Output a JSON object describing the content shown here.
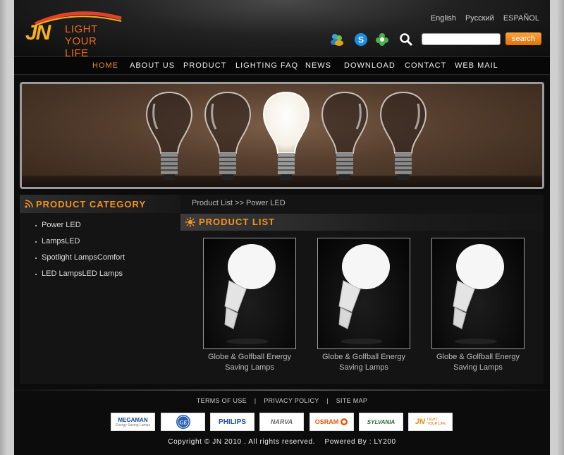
{
  "header": {
    "logo": {
      "initials": "JN",
      "line1": "LIGHT",
      "line2": "YOUR LIFE"
    },
    "languages": [
      "English",
      "Русский",
      "ESPAÑOL"
    ],
    "social_icons": [
      "msn-icon",
      "skype-icon",
      "qq-icon"
    ],
    "search": {
      "placeholder": "",
      "button_label": "search"
    }
  },
  "nav": {
    "items": [
      "HOME",
      "ABOUT US",
      "PRODUCT",
      "LIGHTING FAQ",
      "NEWS",
      "DOWNLOAD",
      "CONTACT",
      "WEB MAIL"
    ],
    "active": "HOME"
  },
  "sidebar": {
    "title": "PRODUCT CATEGORY",
    "items": [
      "Power LED",
      "LampsLED",
      "Spotlight LampsComfort",
      "LED LampsLED Lamps"
    ]
  },
  "main": {
    "breadcrumb": "Product List >> Power LED",
    "title": "PRODUCT LIST",
    "products": [
      {
        "name_line1": "Globe & Golfball Energy",
        "name_line2": "Saving Lamps"
      },
      {
        "name_line1": "Globe & Golfball Energy",
        "name_line2": "Saving Lamps"
      },
      {
        "name_line1": "Globe & Golfball Energy",
        "name_line2": "Saving Lamps"
      }
    ]
  },
  "footer": {
    "links": [
      "TERMS OF USE",
      "PRIVACY POLICY",
      "SITE MAP"
    ],
    "separator": "|",
    "brands": [
      {
        "name": "MEGAMAN",
        "sub": "Energy Saving Lamps",
        "color": "#1a4aa0"
      },
      {
        "name": "GE",
        "color": "#2a5fb0"
      },
      {
        "name": "PHILIPS",
        "color": "#1f4fa0"
      },
      {
        "name": "NARVA",
        "color": "#666666"
      },
      {
        "name": "OSRAM",
        "color": "#e05a10"
      },
      {
        "name": "SYLVANIA",
        "color": "#2b6b3c"
      },
      {
        "name": "JN",
        "line1": "LIGHT",
        "line2": "YOUR LIFE",
        "color": "#f08a1e"
      }
    ],
    "copyright": "Copyright © JN 2010 . All rights reserved.",
    "powered_by": "Powered By : LY200"
  },
  "colors": {
    "accent": "#f39322",
    "nav_active": "#f08a1e",
    "search_button": "#e0710b"
  }
}
